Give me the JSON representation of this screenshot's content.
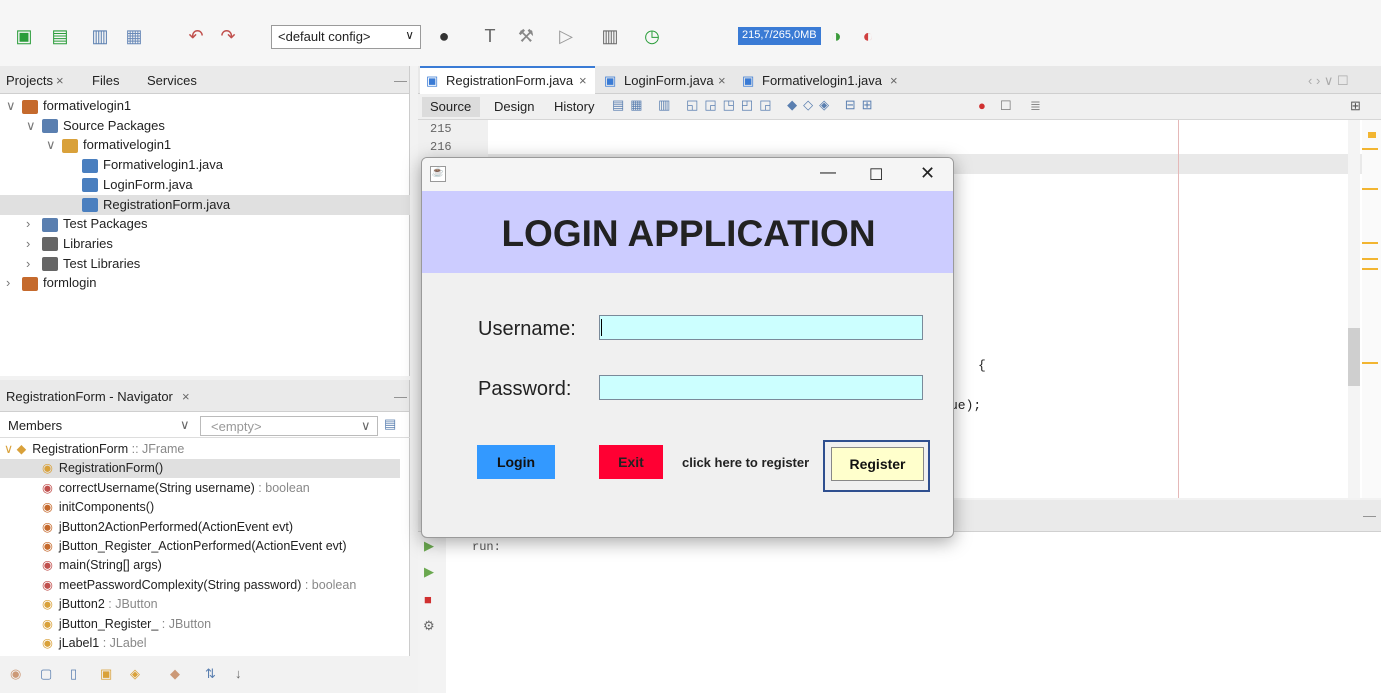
{
  "toolbar": {
    "config_value": "<default config>",
    "memory": "215,7/265,0MB"
  },
  "projects": {
    "tabs": [
      "Projects",
      "Files",
      "Services"
    ],
    "tree": [
      {
        "label": "formativelogin1",
        "indent": 0,
        "expander": "v"
      },
      {
        "label": "Source Packages",
        "indent": 1,
        "expander": "v"
      },
      {
        "label": "formativelogin1",
        "indent": 2,
        "expander": "v"
      },
      {
        "label": "Formativelogin1.java",
        "indent": 3,
        "expander": ""
      },
      {
        "label": "LoginForm.java",
        "indent": 3,
        "expander": ""
      },
      {
        "label": "RegistrationForm.java",
        "indent": 3,
        "expander": "",
        "selected": true
      },
      {
        "label": "Test Packages",
        "indent": 1,
        "expander": ">"
      },
      {
        "label": "Libraries",
        "indent": 1,
        "expander": ">"
      },
      {
        "label": "Test Libraries",
        "indent": 1,
        "expander": ">"
      },
      {
        "label": "formlogin",
        "indent": 0,
        "expander": ">"
      }
    ]
  },
  "navigator": {
    "title": "RegistrationForm - Navigator",
    "members_label": "Members",
    "filter_placeholder": "<empty>",
    "items": [
      {
        "name": "RegistrationForm",
        "type": " :: JFrame",
        "indent": 0
      },
      {
        "name": "RegistrationForm()",
        "type": "",
        "indent": 1,
        "selected": true
      },
      {
        "name": "correctUsername(String username)",
        "type": " : boolean",
        "indent": 1
      },
      {
        "name": "initComponents()",
        "type": "",
        "indent": 1
      },
      {
        "name": "jButton2ActionPerformed(ActionEvent evt)",
        "type": "",
        "indent": 1
      },
      {
        "name": "jButton_Register_ActionPerformed(ActionEvent evt)",
        "type": "",
        "indent": 1
      },
      {
        "name": "main(String[] args)",
        "type": "",
        "indent": 1
      },
      {
        "name": "meetPasswordComplexity(String password)",
        "type": " : boolean",
        "indent": 1
      },
      {
        "name": "jButton2",
        "type": " : JButton",
        "indent": 1
      },
      {
        "name": "jButton_Register_",
        "type": " : JButton",
        "indent": 1
      },
      {
        "name": "jLabel1",
        "type": " : JLabel",
        "indent": 1
      }
    ]
  },
  "editor": {
    "tabs": [
      "RegistrationForm.java",
      "LoginForm.java",
      "Formativelogin1.java"
    ],
    "view_tabs": [
      "Source",
      "Design",
      "History"
    ],
    "line_numbers": [
      "215",
      "216"
    ],
    "code_fragments": [
      "{",
      "ue);"
    ]
  },
  "output": {
    "text": "run:"
  },
  "dialog": {
    "header": "LOGIN APPLICATION",
    "username_label": "Username:",
    "password_label": "Password:",
    "login_button": "Login",
    "exit_button": "Exit",
    "register_hint": "click here to register",
    "register_button": "Register",
    "colors": {
      "header_bg": "#ccccff",
      "field_bg": "#ccffff",
      "login_bg": "#3399ff",
      "exit_bg": "#ff0033",
      "register_bg": "#ffffcc"
    }
  }
}
